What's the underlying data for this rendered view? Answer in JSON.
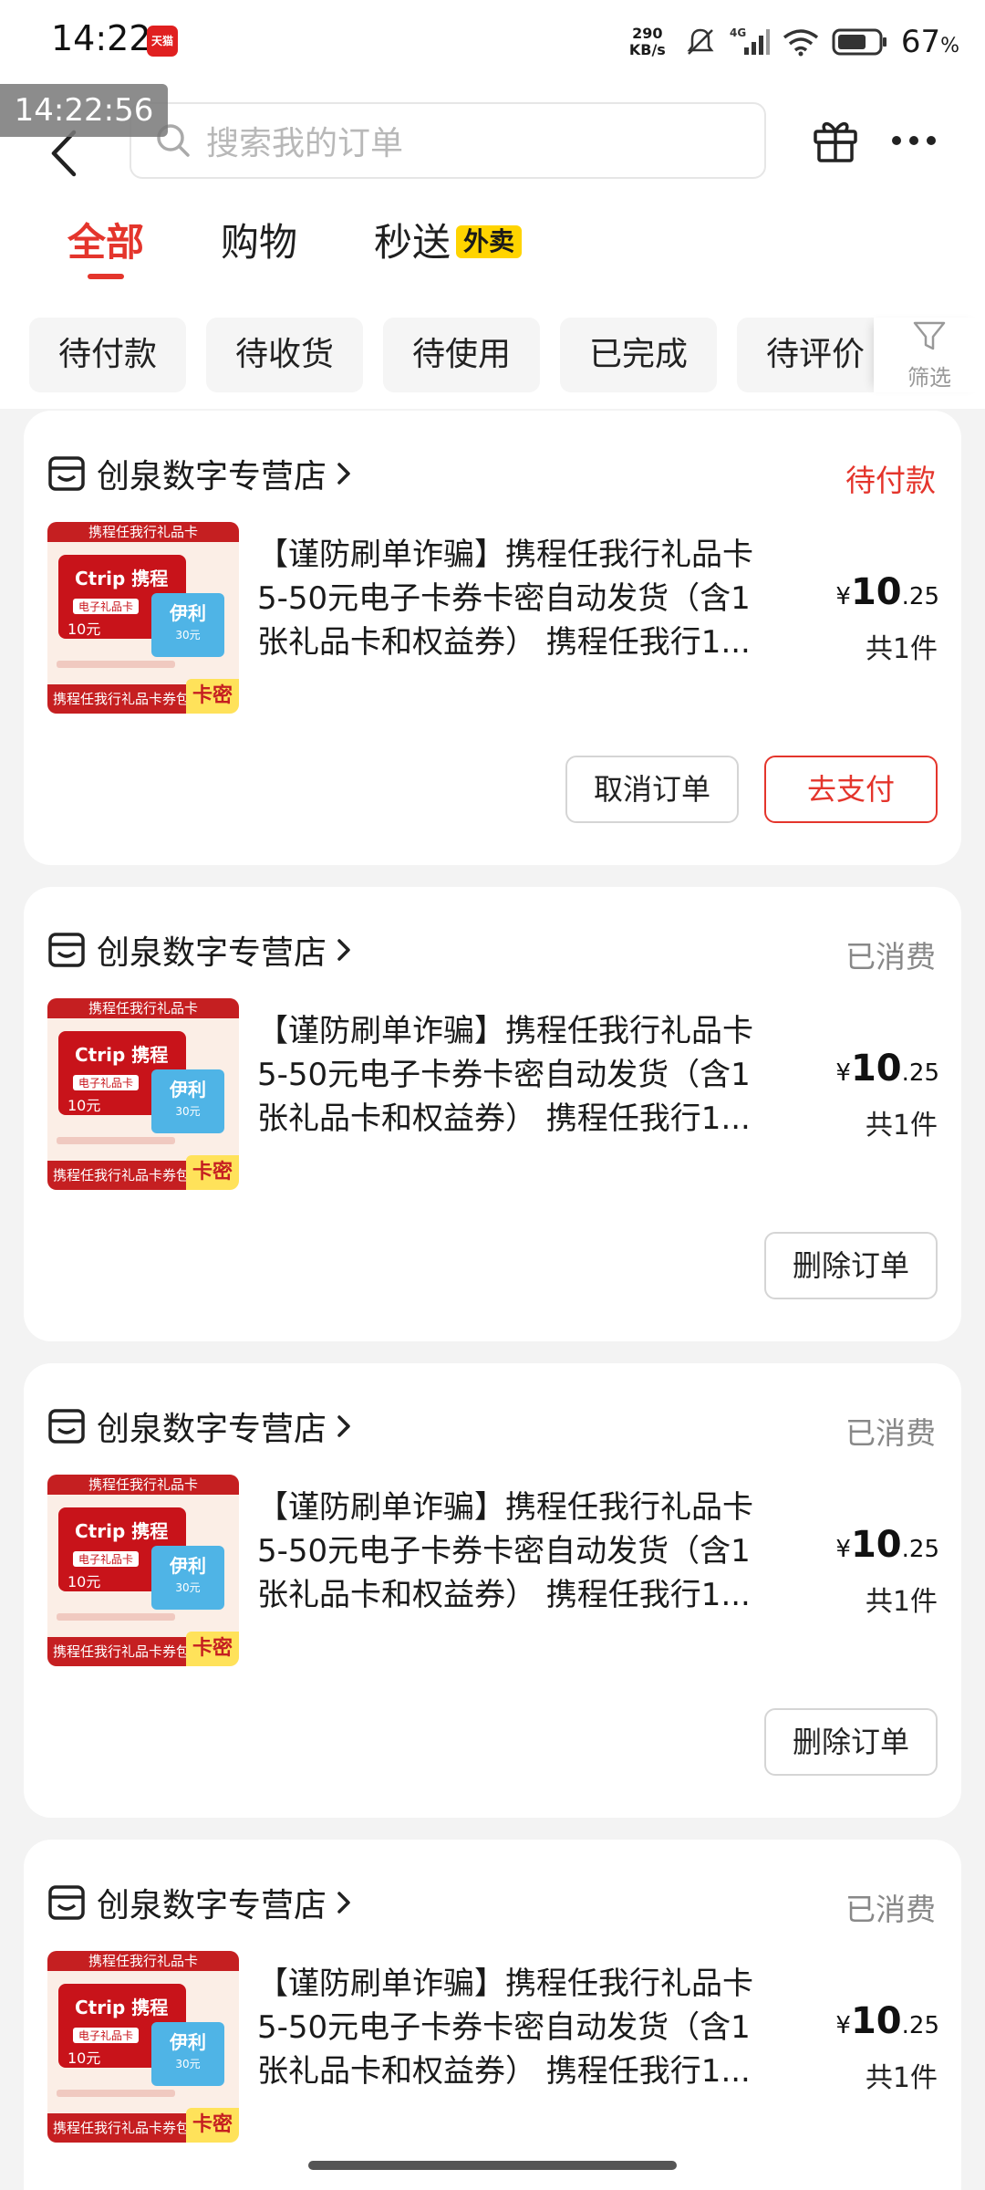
{
  "status_bar": {
    "time": "14:22",
    "app_badge": "天猫",
    "net_speed_value": "290",
    "net_speed_unit": "KB/s",
    "network": "4G",
    "battery_percent": "67",
    "battery_unit": "%"
  },
  "overlay_time": "14:22:56",
  "search": {
    "placeholder": "搜索我的订单"
  },
  "tabs": [
    {
      "label": "全部",
      "active": true
    },
    {
      "label": "购物",
      "active": false
    },
    {
      "label": "秒送",
      "badge": "外卖",
      "active": false
    }
  ],
  "filter_chips": [
    "待付款",
    "待收货",
    "待使用",
    "已完成",
    "待评价"
  ],
  "filter_label": "筛选",
  "thumbnail": {
    "top_text": "携程任我行礼品卡",
    "logo": "Ctrip 携程",
    "card_label": "电子礼品卡",
    "card_value": "10元",
    "benefit_title": "伊利",
    "benefit_text": "30元",
    "bottom_text": "携程任我行礼品卡券包",
    "badge": "卡密"
  },
  "orders": [
    {
      "store": "创泉数字专营店",
      "status": "待付款",
      "status_type": "pay",
      "title_lines": [
        "【谨防刷单诈骗】携程任我行礼品卡",
        "5-50元电子卡券卡密自动发货（含1",
        "张礼品卡和权益券） 携程任我行1..."
      ],
      "currency": "¥",
      "price_int": "10",
      "price_dec": ".25",
      "qty": "共1件",
      "actions": [
        "取消订单",
        "去支付"
      ]
    },
    {
      "store": "创泉数字专营店",
      "status": "已消费",
      "status_type": "done",
      "title_lines": [
        "【谨防刷单诈骗】携程任我行礼品卡",
        "5-50元电子卡券卡密自动发货（含1",
        "张礼品卡和权益券） 携程任我行1..."
      ],
      "currency": "¥",
      "price_int": "10",
      "price_dec": ".25",
      "qty": "共1件",
      "actions": [
        "删除订单"
      ]
    },
    {
      "store": "创泉数字专营店",
      "status": "已消费",
      "status_type": "done",
      "title_lines": [
        "【谨防刷单诈骗】携程任我行礼品卡",
        "5-50元电子卡券卡密自动发货（含1",
        "张礼品卡和权益券） 携程任我行1..."
      ],
      "currency": "¥",
      "price_int": "10",
      "price_dec": ".25",
      "qty": "共1件",
      "actions": [
        "删除订单"
      ]
    },
    {
      "store": "创泉数字专营店",
      "status": "已消费",
      "status_type": "done",
      "title_lines": [
        "【谨防刷单诈骗】携程任我行礼品卡",
        "5-50元电子卡券卡密自动发货（含1",
        "张礼品卡和权益券） 携程任我行1..."
      ],
      "currency": "¥",
      "price_int": "10",
      "price_dec": ".25",
      "qty": "共1件",
      "actions": []
    }
  ],
  "colors": {
    "accent": "#e4352c",
    "waimai_badge": "#ffd400",
    "muted": "#888888"
  }
}
